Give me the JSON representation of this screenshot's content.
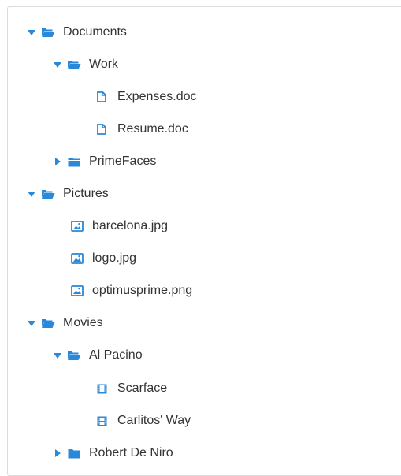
{
  "colors": {
    "accent": "#2a88d8",
    "text": "#333333",
    "border": "#dcdcdc"
  },
  "tree": {
    "documents": {
      "label": "Documents",
      "icon": "folder-open-icon",
      "state": "expanded"
    },
    "work": {
      "label": "Work",
      "icon": "folder-open-icon",
      "state": "expanded"
    },
    "expenses": {
      "label": "Expenses.doc",
      "icon": "document-icon"
    },
    "resume": {
      "label": "Resume.doc",
      "icon": "document-icon"
    },
    "primefaces": {
      "label": "PrimeFaces",
      "icon": "folder-icon",
      "state": "collapsed"
    },
    "pictures": {
      "label": "Pictures",
      "icon": "folder-open-icon",
      "state": "expanded"
    },
    "barcelona": {
      "label": "barcelona.jpg",
      "icon": "image-icon"
    },
    "logo": {
      "label": "logo.jpg",
      "icon": "image-icon"
    },
    "optimusprime": {
      "label": "optimusprime.png",
      "icon": "image-icon"
    },
    "movies": {
      "label": "Movies",
      "icon": "folder-open-icon",
      "state": "expanded"
    },
    "alpacino": {
      "label": "Al Pacino",
      "icon": "folder-open-icon",
      "state": "expanded"
    },
    "scarface": {
      "label": "Scarface",
      "icon": "film-icon"
    },
    "carlitos": {
      "label": "Carlitos' Way",
      "icon": "film-icon"
    },
    "deniro": {
      "label": "Robert De Niro",
      "icon": "folder-icon",
      "state": "collapsed"
    }
  }
}
